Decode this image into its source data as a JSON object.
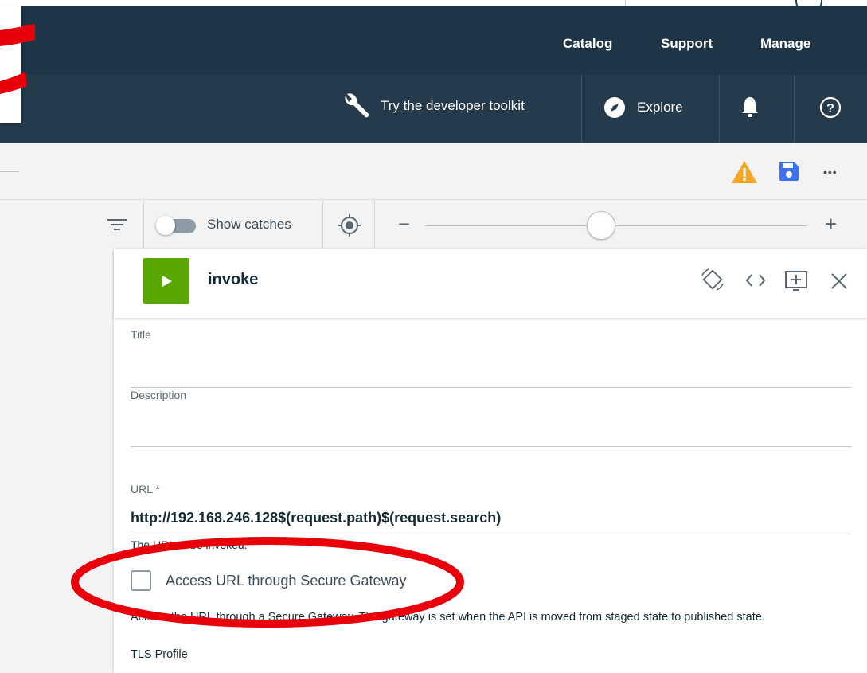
{
  "nav": {
    "links": [
      "Catalog",
      "Support",
      "Manage"
    ],
    "toolkit_label": "Try the developer toolkit",
    "explore_label": "Explore"
  },
  "toolbar": {
    "show_catches_label": "Show catches",
    "show_catches_on": false,
    "zoom_minus": "−",
    "zoom_plus": "+",
    "more_label": "•••"
  },
  "panel": {
    "title": "invoke",
    "fields": {
      "title_label": "Title",
      "title_value": "",
      "description_label": "Description",
      "description_value": "",
      "url_label": "URL *",
      "url_value": "http://192.168.246.128$(request.path)$(request.search)",
      "url_help": "The URL to be invoked.",
      "secure_gateway_label": "Access URL through Secure Gateway",
      "secure_gateway_checked": false,
      "secure_gateway_help": "Access the URL through a Secure Gateway. The gateway is set when the API is moved from staged state to published state.",
      "tls_label": "TLS Profile"
    }
  },
  "colors": {
    "nav_dark": "#1f3545",
    "nav_sub": "#253a4a",
    "accent_green": "#5aa700",
    "save_blue": "#3d70f5",
    "warning_orange": "#f5a623",
    "annotation_red": "#e8000b"
  }
}
